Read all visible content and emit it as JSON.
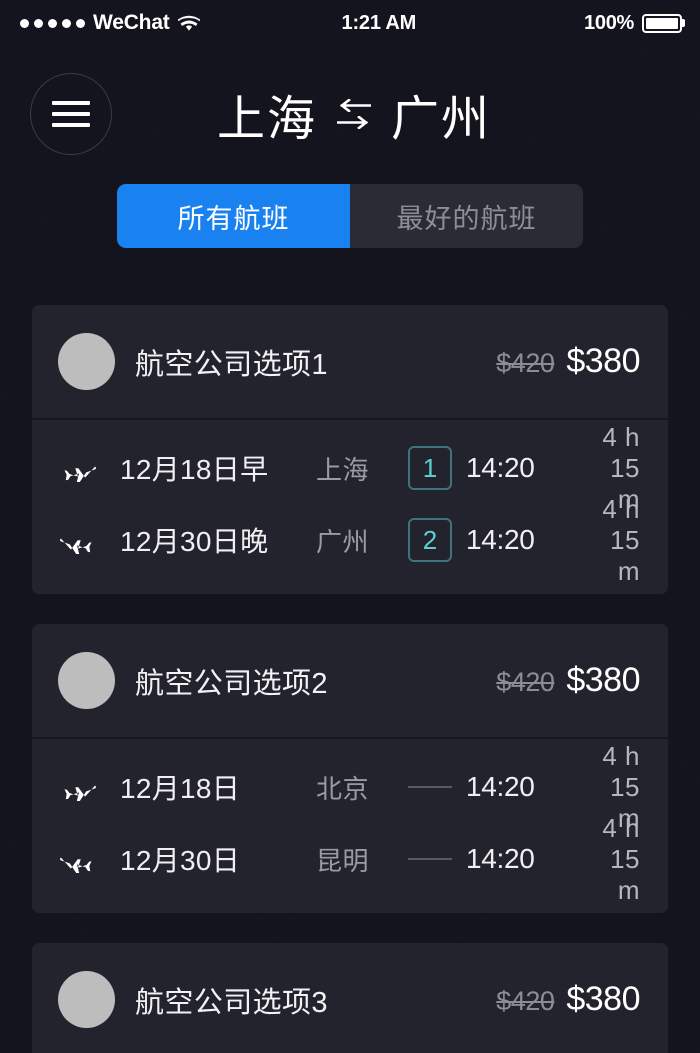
{
  "status_bar": {
    "signal_dots": 5,
    "carrier": "WeChat",
    "wifi_icon": "wifi-icon",
    "time": "1:21 AM",
    "battery_percent": "100%",
    "battery_icon": "battery-full-icon"
  },
  "header": {
    "menu_icon": "hamburger-menu-icon",
    "origin": "上海",
    "swap_icon": "swap-arrows-icon",
    "destination": "广州"
  },
  "segmented_control": {
    "active_index": 0,
    "options": [
      {
        "label": "所有航班",
        "active": true
      },
      {
        "label": "最好的航班",
        "active": false
      }
    ]
  },
  "flights": [
    {
      "airline": "航空公司选项1",
      "price_original": "$420",
      "price_current": "$380",
      "legs": [
        {
          "icon": "airplane-departure-icon",
          "date": "12月18日早",
          "city": "上海",
          "badge": "1",
          "connector": "badge",
          "time": "14:20",
          "duration": "4 h 15 m"
        },
        {
          "icon": "airplane-arrival-icon",
          "date": "12月30日晚",
          "city": "广州",
          "badge": "2",
          "connector": "badge",
          "time": "14:20",
          "duration": "4 h 15 m"
        }
      ]
    },
    {
      "airline": "航空公司选项2",
      "price_original": "$420",
      "price_current": "$380",
      "legs": [
        {
          "icon": "airplane-departure-icon",
          "date": "12月18日",
          "city": "北京",
          "badge": "",
          "connector": "dash",
          "time": "14:20",
          "duration": "4 h 15 m"
        },
        {
          "icon": "airplane-arrival-icon",
          "date": "12月30日",
          "city": "昆明",
          "badge": "",
          "connector": "dash",
          "time": "14:20",
          "duration": "4 h 15 m"
        }
      ]
    },
    {
      "airline": "航空公司选项3",
      "price_original": "$420",
      "price_current": "$380",
      "legs": []
    }
  ],
  "colors": {
    "page_background": "#14141f",
    "card_background": "#23232e",
    "accent_blue": "#1a82f0",
    "segment_inactive": "#2b2b35",
    "badge_teal": "#5ccfd4",
    "badge_border": "#40727a",
    "muted_text": "#9b9ba6",
    "price_old": "#8c8c96"
  }
}
